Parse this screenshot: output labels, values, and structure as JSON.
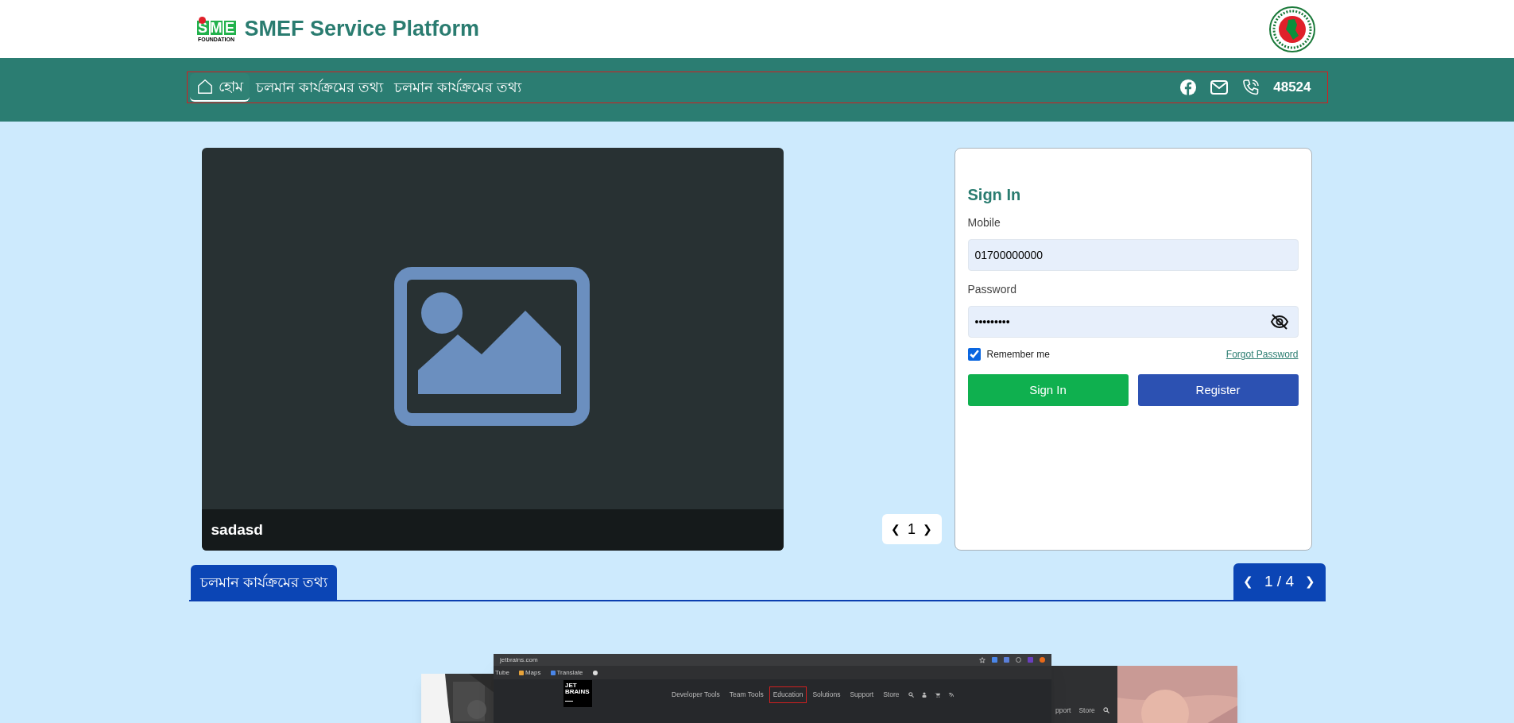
{
  "header": {
    "logo_letters": [
      "S",
      "M",
      "E"
    ],
    "logo_subtext": "FOUNDATION",
    "title": "SMEF Service Platform"
  },
  "nav": {
    "items": [
      {
        "label": "হোম",
        "kind": "home",
        "selected": true
      },
      {
        "label": "চলমান কার্যক্রমের তথ্য",
        "kind": "link",
        "selected": false
      },
      {
        "label": "চলমান কার্যক্রমের তথ্য",
        "kind": "link",
        "selected": false
      }
    ],
    "phone": "48524"
  },
  "slider": {
    "caption": "sadasd",
    "pager": {
      "prev": "❮",
      "page": "1",
      "next": "❯"
    }
  },
  "sign_in": {
    "title": "Sign In",
    "mobile": {
      "label": "Mobile",
      "value": "01700000000"
    },
    "password": {
      "label": "Password",
      "value": "•••••••••"
    },
    "remember": {
      "label": "Remember me",
      "checked": true
    },
    "forgot": "Forgot Password",
    "buttons": [
      {
        "label": "Sign In",
        "kind": "primary"
      },
      {
        "label": "Register",
        "kind": "secondary"
      }
    ]
  },
  "section": {
    "tab": "চলমান কার্যক্রমের তথ্য",
    "pager": {
      "prev": "❮",
      "page": "1 / 4",
      "next": "❯"
    }
  },
  "gallery": {
    "screenshot": {
      "url": "jetbrains.com",
      "bookmarks": [
        "Tube",
        "Maps",
        "Translate"
      ],
      "logo": [
        "JET",
        "BRAINS"
      ],
      "menu": [
        {
          "label": "Developer Tools",
          "selected": false
        },
        {
          "label": "Team Tools",
          "selected": false
        },
        {
          "label": "Education",
          "selected": true
        },
        {
          "label": "Solutions",
          "selected": false
        },
        {
          "label": "Support",
          "selected": false
        },
        {
          "label": "Store",
          "selected": false
        }
      ]
    },
    "side_screenshot": {
      "menu": [
        "pport",
        "Store"
      ]
    }
  }
}
